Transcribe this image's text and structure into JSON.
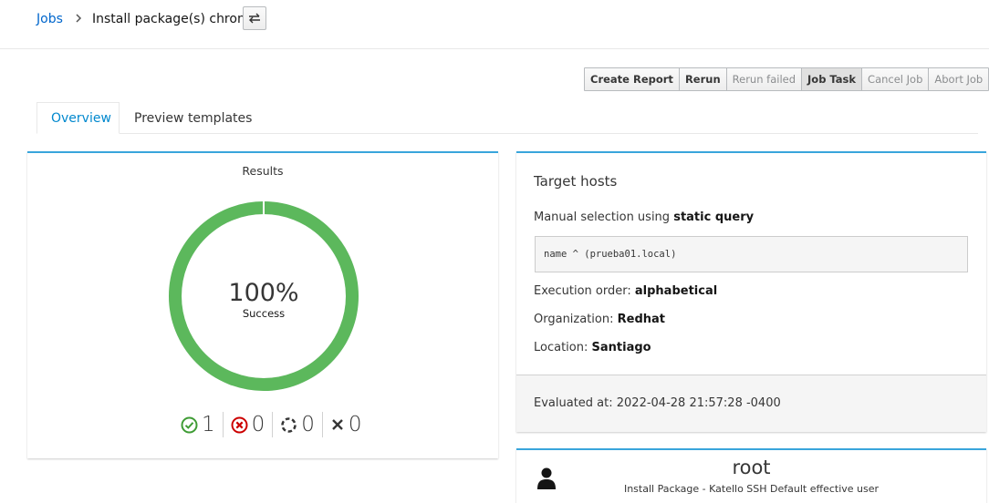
{
  "breadcrumb": {
    "parent": "Jobs",
    "current": "Install package(s) chrony"
  },
  "toolbar": {
    "buttons": [
      {
        "label": "Create Report",
        "enabled": true
      },
      {
        "label": "Rerun",
        "enabled": true
      },
      {
        "label": "Rerun failed",
        "enabled": false
      },
      {
        "label": "Job Task",
        "enabled": true,
        "active": true
      },
      {
        "label": "Cancel Job",
        "enabled": false
      },
      {
        "label": "Abort Job",
        "enabled": false
      }
    ]
  },
  "tabs": [
    {
      "label": "Overview",
      "active": true
    },
    {
      "label": "Preview templates",
      "active": false
    }
  ],
  "results": {
    "title": "Results",
    "percent": "100%",
    "percent_value": 100,
    "status": "Success",
    "success_color": "#5cb85c",
    "counts": {
      "success": "1",
      "failed": "0",
      "pending": "0",
      "cancelled": "0"
    }
  },
  "target_hosts": {
    "title": "Target hosts",
    "selection_prefix": "Manual selection using",
    "selection_method": "static query",
    "query": "name ^ (prueba01.local)",
    "execution_order_label": "Execution order:",
    "execution_order": "alphabetical",
    "organization_label": "Organization:",
    "organization": "Redhat",
    "location_label": "Location:",
    "location": "Santiago",
    "evaluated_label": "Evaluated at:",
    "evaluated_at": "2022-04-28 21:57:28 -0400"
  },
  "user": {
    "name": "root",
    "description": "Install Package - Katello SSH Default effective user"
  },
  "colors": {
    "accent": "#39a5dc",
    "link": "#0066cc",
    "success": "#3f9c35",
    "danger": "#cc0000"
  }
}
